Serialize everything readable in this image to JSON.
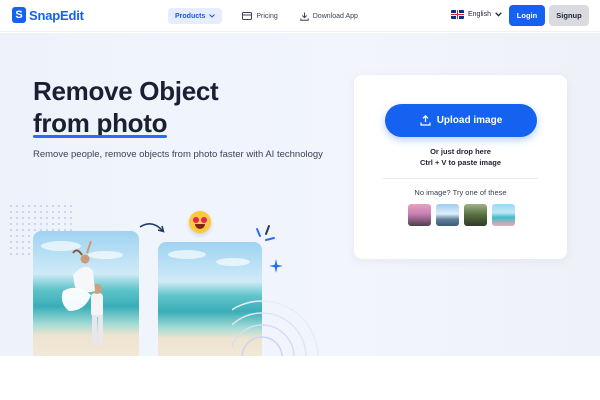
{
  "header": {
    "logo_mark": "S",
    "logo_text": "SnapEdit",
    "nav": {
      "products": "Products",
      "pricing": "Pricing",
      "download": "Download App"
    },
    "language": "English",
    "login": "Login",
    "signup": "Signup"
  },
  "hero": {
    "headline_line1": "Remove Object",
    "headline_line2": "from photo",
    "subtitle": "Remove people, remove objects from photo faster with AI technology"
  },
  "upload_card": {
    "upload_label": "Upload image",
    "drop_line1": "Or just drop here",
    "drop_line2": "Ctrl + V to paste image",
    "no_image_text": "No image? Try one of these"
  },
  "colors": {
    "brand": "#1561f0",
    "accent_light": "#e6edff"
  },
  "icons": [
    "logo-icon",
    "chevron-down-icon",
    "pricing-card-icon",
    "download-icon",
    "uk-flag-icon",
    "upload-icon",
    "sparkle-icon",
    "arrow-icon",
    "emoji-icon"
  ]
}
